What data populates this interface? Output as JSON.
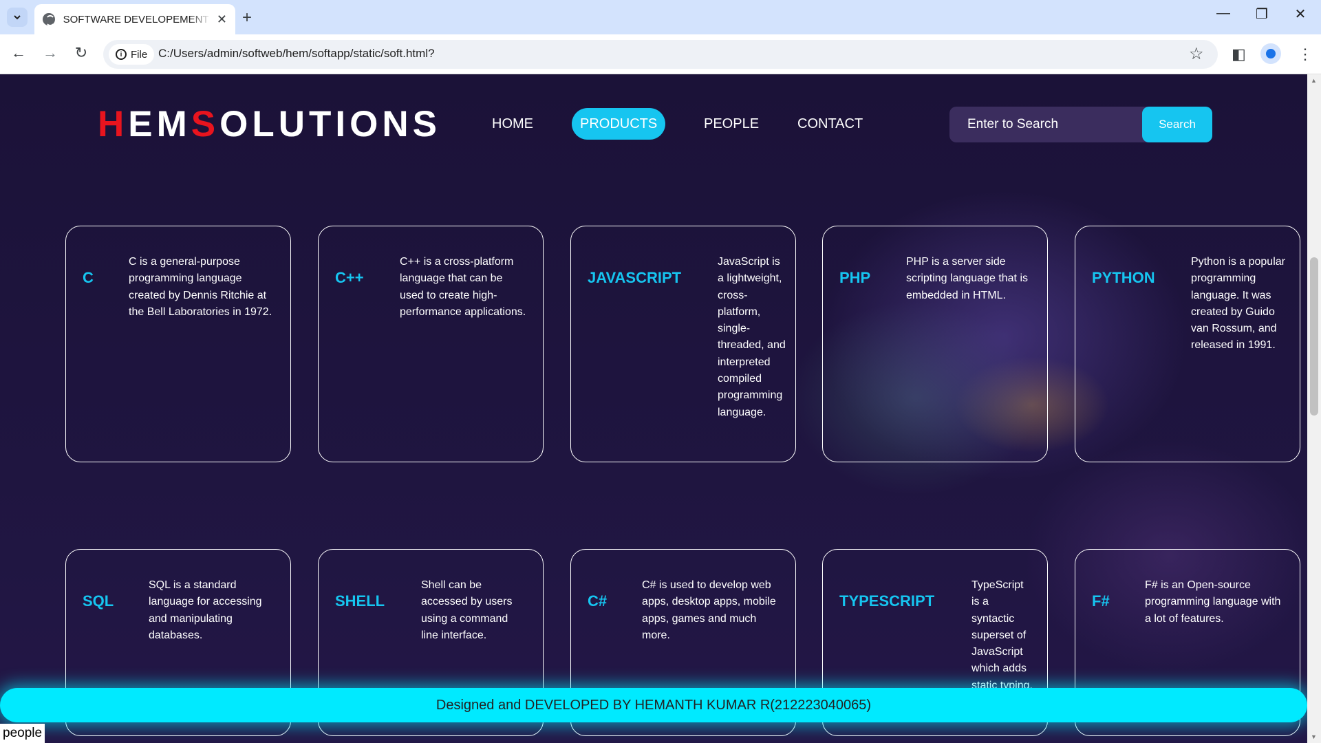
{
  "browser": {
    "tab_title": "SOFTWARE DEVELOPEMENT C",
    "new_tab": "+",
    "url_chip": "File",
    "url": "C:/Users/admin/softweb/hem/softapp/static/soft.html?"
  },
  "site": {
    "logo": {
      "h": "H",
      "em": "EM",
      "s": "S",
      "olutions": "OLUTIONS"
    },
    "nav": [
      "HOME",
      "PRODUCTS",
      "PEOPLE",
      "CONTACT"
    ],
    "active_nav": "PRODUCTS",
    "search": {
      "placeholder": "Enter to Search",
      "button": "Search"
    }
  },
  "cards_row1": [
    {
      "name": "C",
      "desc": "C is a general-purpose programming language created by Dennis Ritchie at the Bell Laboratories in 1972."
    },
    {
      "name": "C++",
      "desc": "C++ is a cross-platform language that can be used to create high-performance applications."
    },
    {
      "name": "JAVASCRIPT",
      "desc": "JavaScript is a lightweight, cross-platform, single-threaded, and interpreted compiled programming language."
    },
    {
      "name": "PHP",
      "desc": "PHP is a server side scripting language that is embedded in HTML."
    },
    {
      "name": "PYTHON",
      "desc": "Python is a popular programming language. It was created by Guido van Rossum, and released in 1991."
    }
  ],
  "cards_row2": [
    {
      "name": "SQL",
      "desc": "SQL is a standard language for accessing and manipulating databases."
    },
    {
      "name": "SHELL",
      "desc": "Shell can be accessed by users using a command line interface."
    },
    {
      "name": "C#",
      "desc": "C# is used to develop web apps, desktop apps, mobile apps, games and much more."
    },
    {
      "name": "TYPESCRIPT",
      "desc": "TypeScript is a syntactic superset of JavaScript which adds static typing."
    },
    {
      "name": "F#",
      "desc": "F# is an Open-source programming language with a lot of features."
    }
  ],
  "footer": "Designed and DEVELOPED BY HEMANTH KUMAR R(212223040065)",
  "status_text": "people",
  "colors": {
    "accent": "#16c5f0",
    "logo_red": "#e8141e",
    "footer": "#00eaff",
    "page_bg": "#1b1238"
  }
}
